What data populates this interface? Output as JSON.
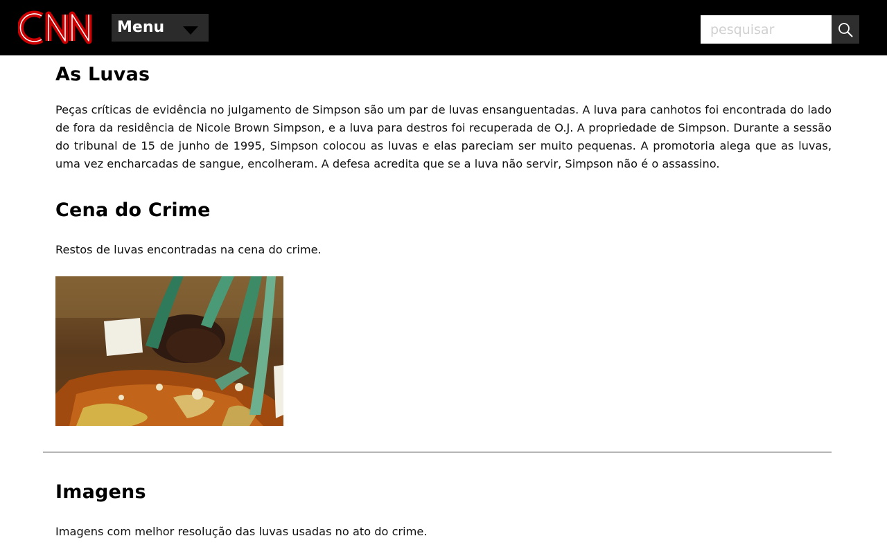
{
  "header": {
    "logo_text": "CNN",
    "menu_label": "Menu",
    "search": {
      "placeholder": "pesquisar",
      "value": ""
    },
    "colors": {
      "bar": "#000000",
      "logo_red": "#cc0000"
    }
  },
  "sections": {
    "luvas": {
      "title": "As Luvas",
      "body": "Peças críticas de evidência no julgamento de Simpson são um par de luvas ensanguentadas. A luva para canhotos foi encontrada do lado de fora da residência de Nicole Brown Simpson, e a luva para destros foi recuperada de O.J. A propriedade de Simpson. Durante a sessão do tribunal de 15 de junho de 1995, Simpson colocou as luvas e elas pareciam ser muito pequenas. A promotoria alega que as luvas, uma vez encharcadas de sangue, encolheram. A defesa acredita que se a luva não servir, Simpson não é o assassino."
    },
    "cena": {
      "title": "Cena do Crime",
      "body": "Restos de luvas encontradas na cena do crime."
    },
    "imagens": {
      "title": "Imagens",
      "body": "Imagens com melhor resolução das luvas usadas no ato do crime."
    }
  },
  "icons": {
    "search": "search-icon",
    "menu_caret": "chevron-down-icon"
  }
}
